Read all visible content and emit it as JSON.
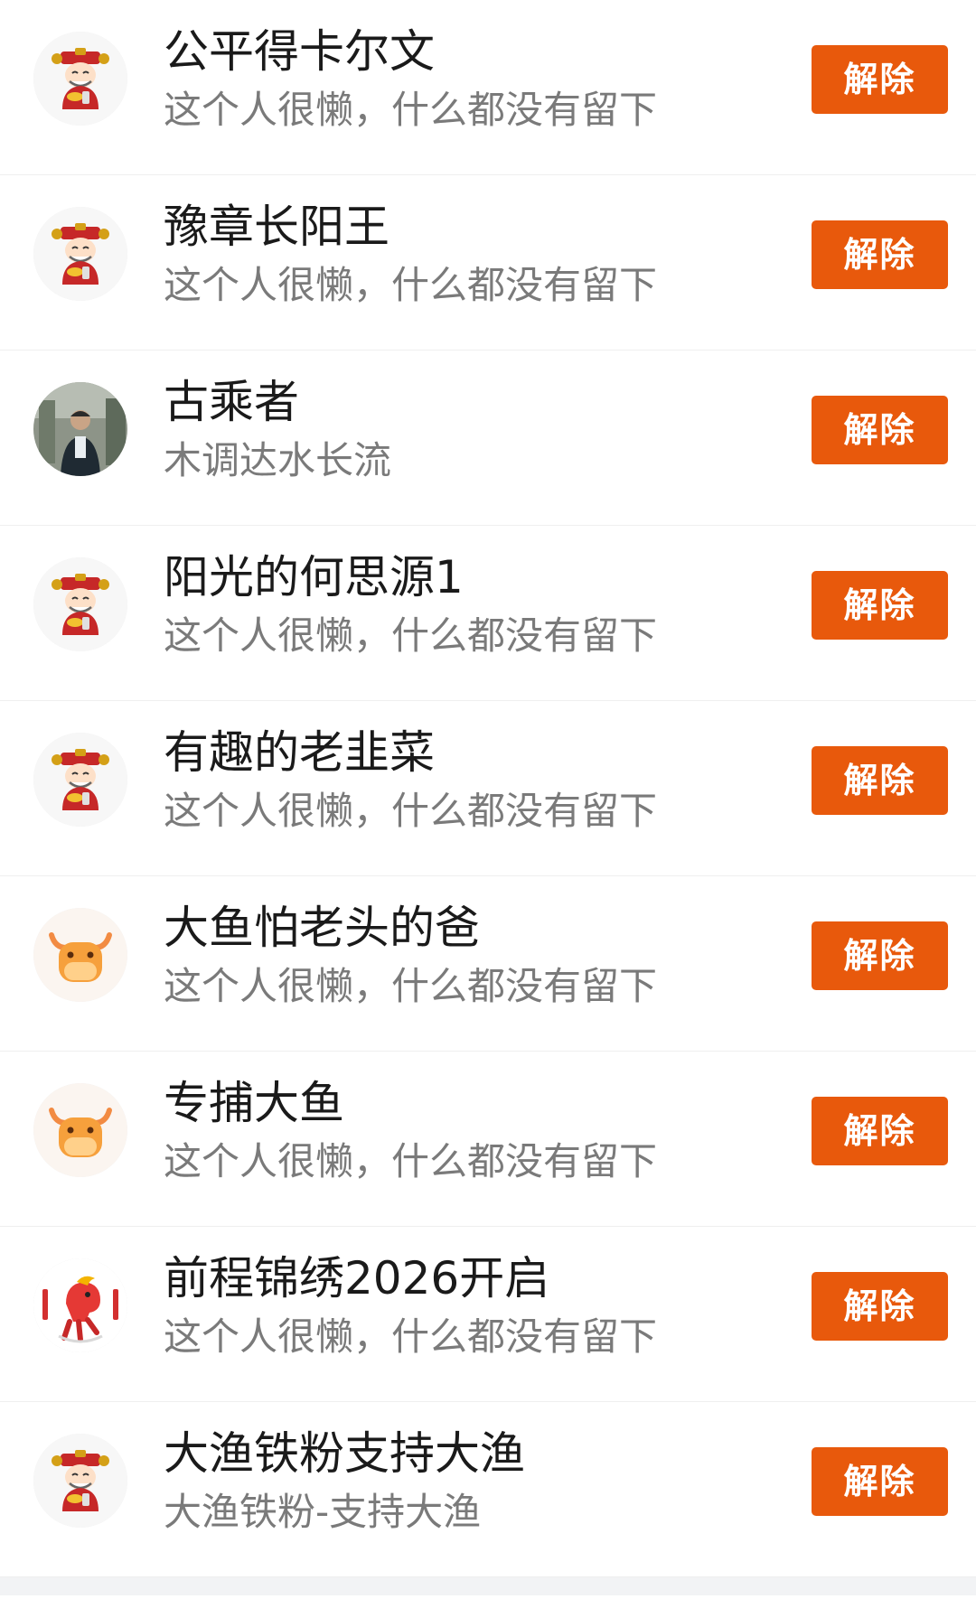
{
  "button_label": "解除",
  "colors": {
    "accent": "#e8590c",
    "name_text": "#1a1a1a",
    "bio_text": "#7a7a7a",
    "divider": "#efefef"
  },
  "users": [
    {
      "name": "公平得卡尔文",
      "bio": "这个人很懒，什么都没有留下",
      "avatar": "caishen-avatar"
    },
    {
      "name": "豫章长阳王",
      "bio": "这个人很懒，什么都没有留下",
      "avatar": "caishen-avatar"
    },
    {
      "name": "古乘者",
      "bio": "木调达水长流",
      "avatar": "photo-avatar"
    },
    {
      "name": "阳光的何思源1",
      "bio": "这个人很懒，什么都没有留下",
      "avatar": "caishen-avatar"
    },
    {
      "name": "有趣的老韭菜",
      "bio": "这个人很懒，什么都没有留下",
      "avatar": "caishen-avatar"
    },
    {
      "name": "大鱼怕老头的爸",
      "bio": "这个人很懒，什么都没有留下",
      "avatar": "bull-avatar"
    },
    {
      "name": "专捕大鱼",
      "bio": "这个人很懒，什么都没有留下",
      "avatar": "bull-avatar"
    },
    {
      "name": "前程锦绣2026开启",
      "bio": "这个人很懒，什么都没有留下",
      "avatar": "horse-avatar"
    },
    {
      "name": "大渔铁粉支持大渔",
      "bio": "大渔铁粉-支持大渔",
      "avatar": "caishen-avatar"
    }
  ]
}
